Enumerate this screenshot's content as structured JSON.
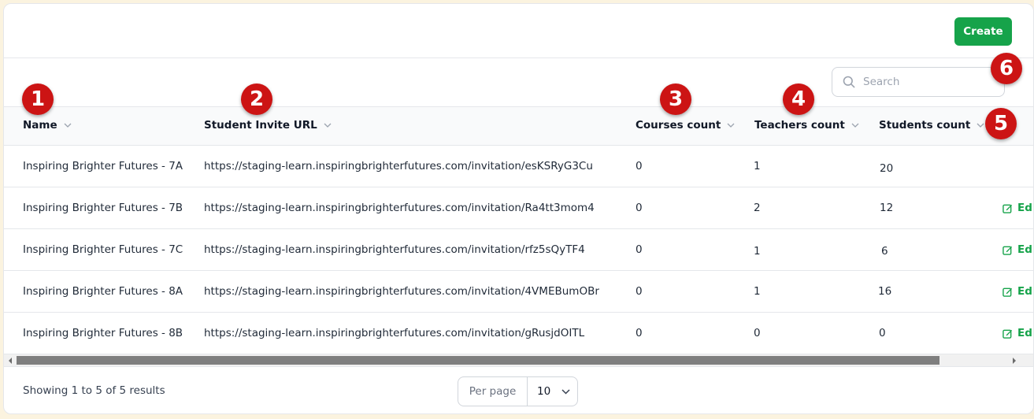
{
  "header": {
    "create_label": "Create"
  },
  "search": {
    "placeholder": "Search",
    "value": ""
  },
  "table": {
    "columns": [
      "Name",
      "Student Invite URL",
      "Courses count",
      "Teachers count",
      "Students count"
    ],
    "rows": [
      {
        "name": "Inspiring Brighter Futures - 7A",
        "url": "https://staging-learn.inspiringbrighterfutures.com/invitation/esKSRyG3Cu",
        "courses": "0",
        "teachers": "1",
        "students": "20",
        "edit": ""
      },
      {
        "name": "Inspiring Brighter Futures - 7B",
        "url": "https://staging-learn.inspiringbrighterfutures.com/invitation/Ra4tt3mom4",
        "courses": "0",
        "teachers": "2",
        "students": "12",
        "edit": "Ed"
      },
      {
        "name": "Inspiring Brighter Futures - 7C",
        "url": "https://staging-learn.inspiringbrighterfutures.com/invitation/rfz5sQyTF4",
        "courses": "0",
        "teachers": "1",
        "students": "6",
        "edit": "Ed"
      },
      {
        "name": "Inspiring Brighter Futures - 8A",
        "url": "https://staging-learn.inspiringbrighterfutures.com/invitation/4VMEBumOBr",
        "courses": "0",
        "teachers": "1",
        "students": "16",
        "edit": "Ed"
      },
      {
        "name": "Inspiring Brighter Futures - 8B",
        "url": "https://staging-learn.inspiringbrighterfutures.com/invitation/gRusjdOITL",
        "courses": "0",
        "teachers": "0",
        "students": "0",
        "edit": "Ed"
      }
    ]
  },
  "footer": {
    "results_text": "Showing 1 to 5 of 5 results",
    "per_page_label": "Per page",
    "per_page_value": "10"
  },
  "annotations": [
    "1",
    "2",
    "3",
    "4",
    "5",
    "6"
  ],
  "colors": {
    "accent": "#16a34a",
    "badge": "#cc1414",
    "background": "#fbf3df"
  },
  "icons": {
    "search": "search-icon",
    "sort": "chevron-down-icon",
    "edit": "edit-icon"
  }
}
